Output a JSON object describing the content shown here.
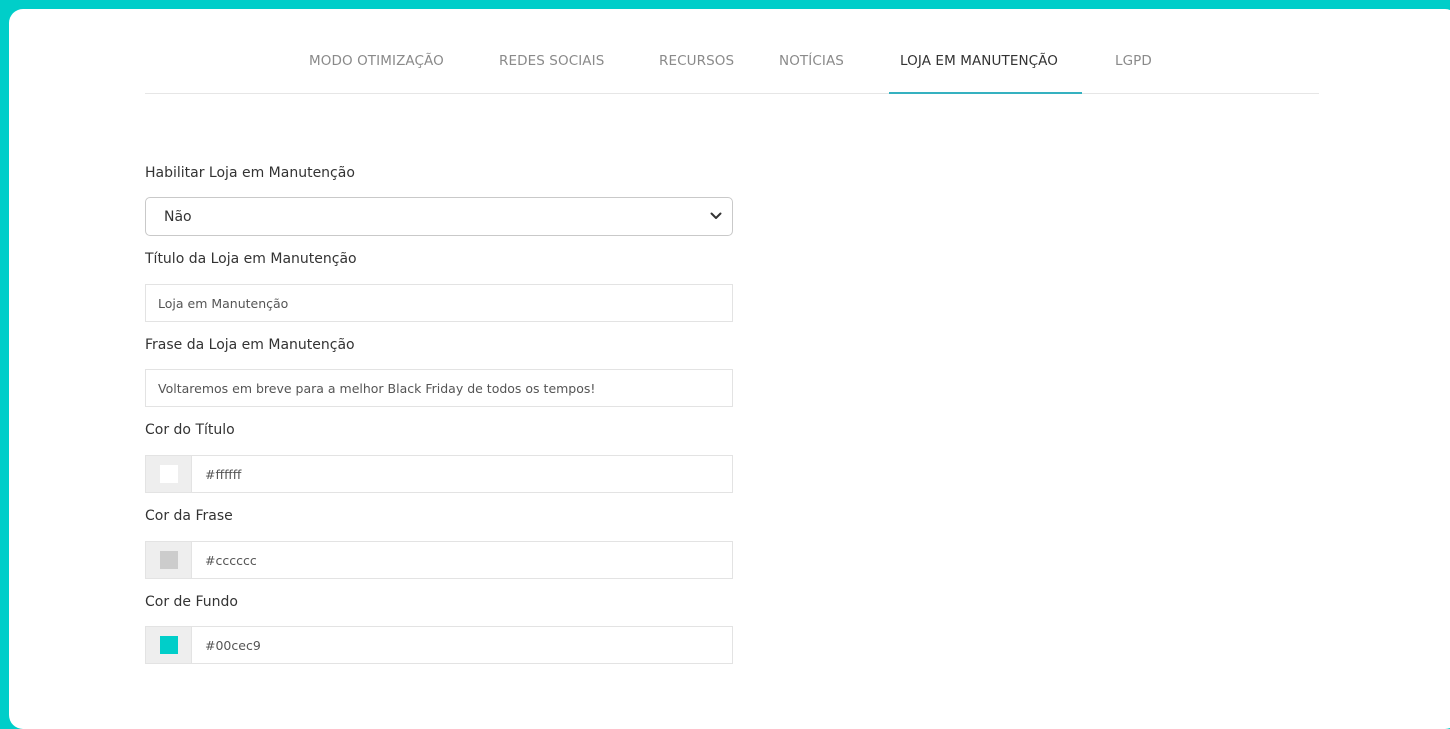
{
  "tabs": [
    {
      "label": "MODO OTIMIZAÇÃO",
      "active": false
    },
    {
      "label": "REDES SOCIAIS",
      "active": false
    },
    {
      "label": "RECURSOS",
      "active": false
    },
    {
      "label": "NOTÍCIAS",
      "active": false
    },
    {
      "label": "LOJA EM MANUTENÇÃO",
      "active": true
    },
    {
      "label": "LGPD",
      "active": false
    }
  ],
  "form": {
    "enable": {
      "label": "Habilitar Loja em Manutenção",
      "value": "Não"
    },
    "title": {
      "label": "Título da Loja em Manutenção",
      "value": "Loja em Manutenção"
    },
    "phrase": {
      "label": "Frase da Loja em Manutenção",
      "value": "Voltaremos em breve para a melhor Black Friday de todos os tempos!"
    },
    "title_color": {
      "label": "Cor do Título",
      "value": "#ffffff"
    },
    "phrase_color": {
      "label": "Cor da Frase",
      "value": "#cccccc"
    },
    "bg_color": {
      "label": "Cor de Fundo",
      "value": "#00cec9"
    }
  },
  "colors": {
    "accent": "#00cec9",
    "tab_underline": "#35b1c0"
  },
  "icons": {
    "select_arrow": "chevron-down-icon"
  }
}
